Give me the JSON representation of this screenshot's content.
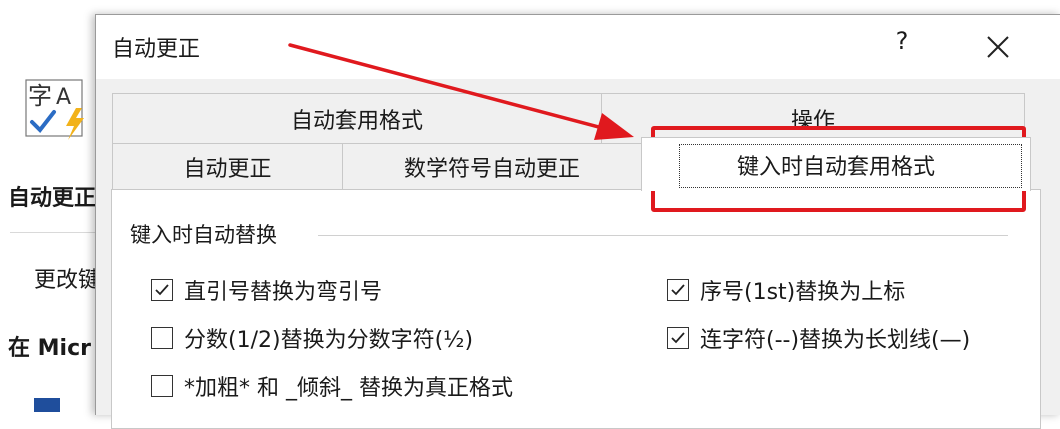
{
  "background_window": {
    "partial_title": "自动更正",
    "partial_label": "更改键",
    "partial_heading": "在 Micr"
  },
  "dialog": {
    "title": "自动更正",
    "help_label": "?",
    "tabs_row_back": [
      "自动套用格式",
      "操作"
    ],
    "tabs_row_front": [
      "自动更正",
      "数学符号自动更正",
      "键入时自动套用格式"
    ],
    "active_tab": "键入时自动套用格式"
  },
  "group": {
    "title": "键入时自动替换",
    "options_left": [
      {
        "label": "直引号替换为弯引号",
        "checked": true
      },
      {
        "label": "分数(1/2)替换为分数字符(½)",
        "checked": false
      },
      {
        "label": "*加粗* 和 _倾斜_ 替换为真正格式",
        "checked": false
      }
    ],
    "options_right": [
      {
        "label": "序号(1st)替换为上标",
        "checked": true
      },
      {
        "label": "连字符(--)替换为长划线(—)",
        "checked": true
      }
    ]
  },
  "annotation": {
    "color": "#e0191e"
  },
  "icons": {
    "app": "autocorrect-icon",
    "close": "close-icon",
    "check": "check-icon"
  }
}
